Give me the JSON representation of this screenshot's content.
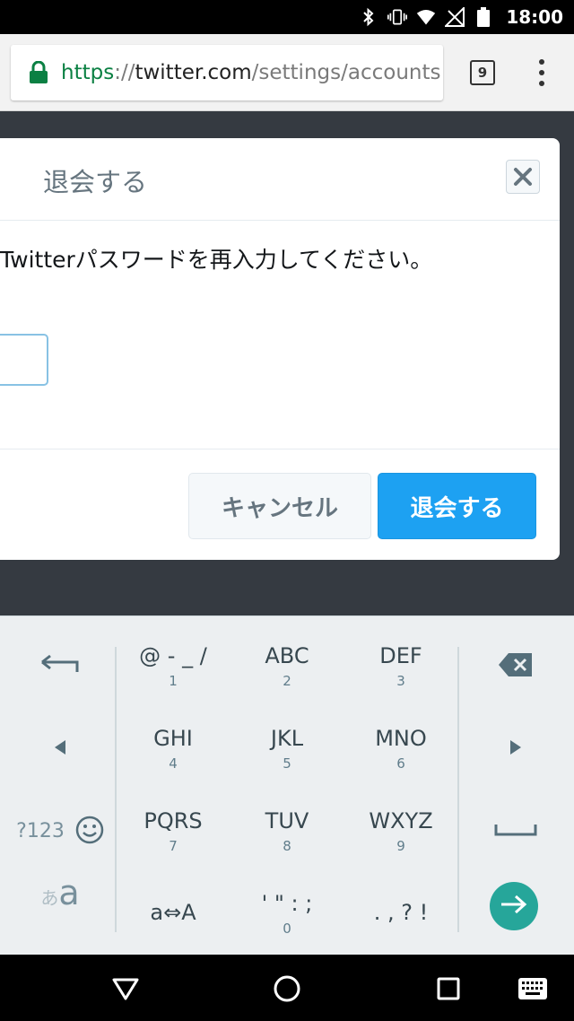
{
  "status_bar": {
    "time": "18:00",
    "icons": [
      "bluetooth-icon",
      "vibrate-icon",
      "wifi-icon",
      "no-signal-icon",
      "battery-icon"
    ]
  },
  "browser": {
    "url_scheme": "https",
    "url_separator": "://",
    "url_host": "twitter.com",
    "url_path": "/settings/accounts",
    "tab_count": "9",
    "colors": {
      "secure": "#0b8043"
    }
  },
  "dialog": {
    "title": "退会する",
    "prompt": "Twitterパスワードを再入力してください。",
    "password_value": "",
    "cancel_label": "キャンセル",
    "deactivate_label": "退会する",
    "colors": {
      "primary": "#1da1f2"
    }
  },
  "keyboard": {
    "keys": [
      {
        "main": "@ - _ /",
        "sub": "1"
      },
      {
        "main": "ABC",
        "sub": "2"
      },
      {
        "main": "DEF",
        "sub": "3"
      },
      {
        "main": "GHI",
        "sub": "4"
      },
      {
        "main": "JKL",
        "sub": "5"
      },
      {
        "main": "MNO",
        "sub": "6"
      },
      {
        "main": "PQRS",
        "sub": "7"
      },
      {
        "main": "TUV",
        "sub": "8"
      },
      {
        "main": "WXYZ",
        "sub": "9"
      },
      {
        "main": "a⇔A",
        "sub": ""
      },
      {
        "main": "' \" : ;",
        "sub": "0"
      },
      {
        "main": ". , ? !",
        "sub": ""
      }
    ],
    "symbols_label": "?123",
    "kana_label_small": "あ",
    "kana_label_big": "a",
    "colors": {
      "enter": "#26a69a"
    }
  },
  "nav_bar": {
    "buttons": [
      "back-icon",
      "home-icon",
      "recents-icon",
      "keyboard-switch-icon"
    ]
  }
}
